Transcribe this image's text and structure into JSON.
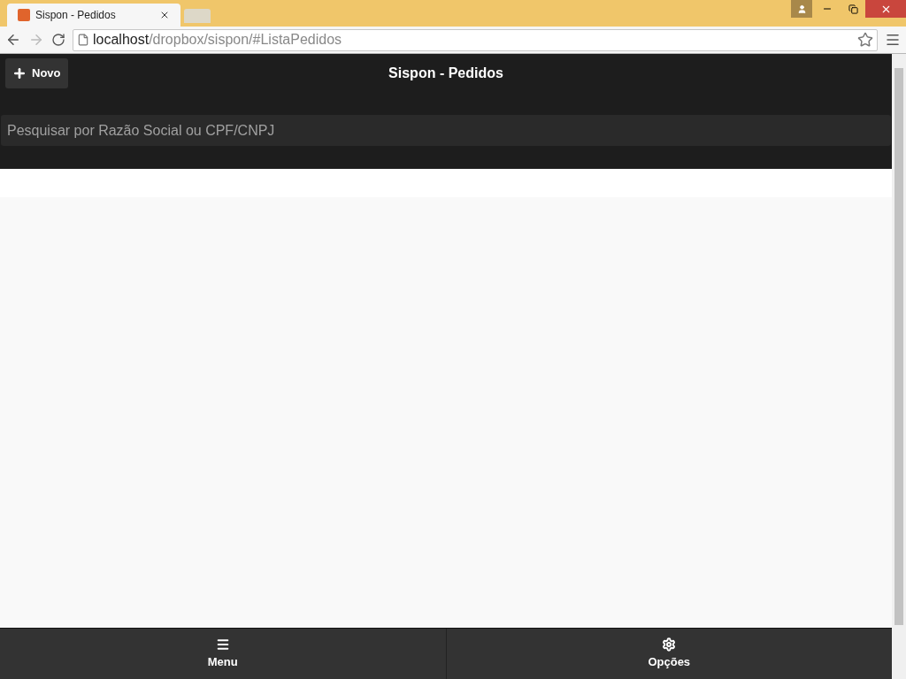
{
  "browser": {
    "tab_title": "Sispon - Pedidos",
    "url_host": "localhost",
    "url_path": "/dropbox/sispon/#ListaPedidos"
  },
  "header": {
    "new_button": "Novo",
    "title": "Sispon - Pedidos"
  },
  "search": {
    "placeholder": "Pesquisar por Razão Social ou CPF/CNPJ"
  },
  "footer": [
    {
      "kind": "menu",
      "label": "Menu"
    },
    {
      "kind": "gear",
      "label": "Opções"
    }
  ]
}
